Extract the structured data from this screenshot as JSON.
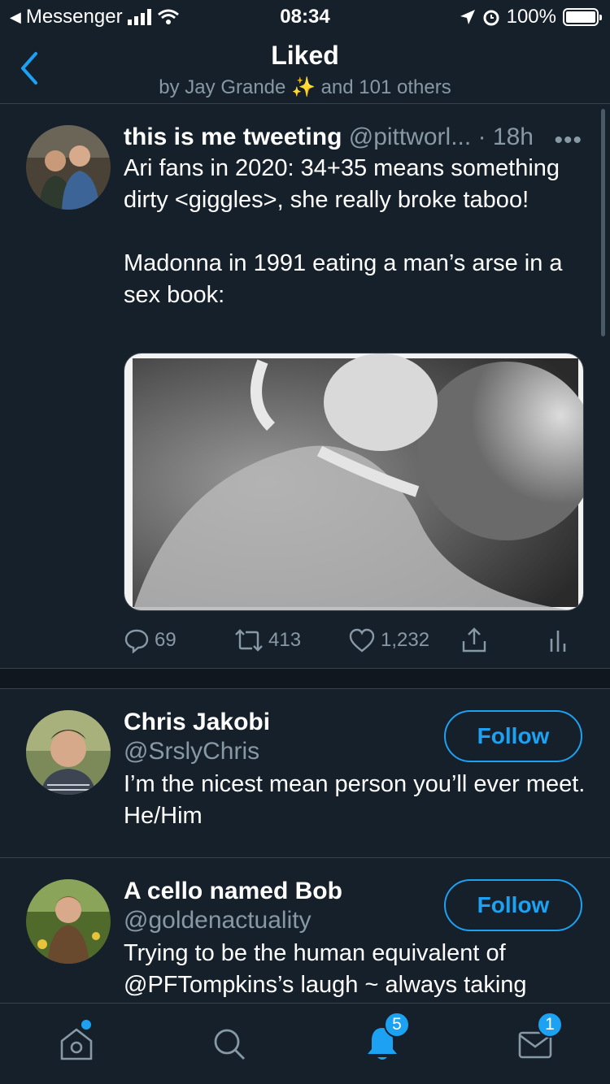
{
  "status_bar": {
    "back_app": "Messenger",
    "time": "08:34",
    "battery": "100%",
    "battery_level": 1.0
  },
  "nav": {
    "title": "Liked",
    "subtitle": "by Jay Grande ✨ and 101 others"
  },
  "tweet": {
    "name": "this is me tweeting",
    "handle": "@pittworl...",
    "time": "· 18h",
    "text": "Ari fans in 2020: 34+35 means something dirty <giggles>, she really broke taboo!\n\nMadonna in 1991 eating a man’s arse in a sex book:",
    "replies": "69",
    "retweets": "413",
    "likes": "1,232"
  },
  "users": [
    {
      "name": "Chris Jakobi",
      "handle": "@SrslyChris",
      "bio": "I’m the nicest mean person you’ll ever meet. He/Him",
      "follow_label": "Follow"
    },
    {
      "name": "A cello named Bob",
      "handle": "@goldenactuality",
      "bio": "Trying to be the human equivalent of @PFTompkins’s laugh ~ always taking",
      "follow_label": "Follow"
    }
  ],
  "tabbar": {
    "notifications_badge": "5",
    "messages_badge": "1"
  },
  "colors": {
    "background": "#15202b",
    "accent": "#1da1f2",
    "muted": "#8899a6",
    "border": "#38444d"
  },
  "icons": [
    "back-chevron-icon",
    "signal-icon",
    "wifi-icon",
    "location-icon",
    "alarm-icon",
    "battery-icon",
    "more-icon",
    "reply-icon",
    "retweet-icon",
    "like-icon",
    "share-icon",
    "analytics-icon",
    "home-icon",
    "search-icon",
    "bell-icon",
    "mail-icon"
  ]
}
